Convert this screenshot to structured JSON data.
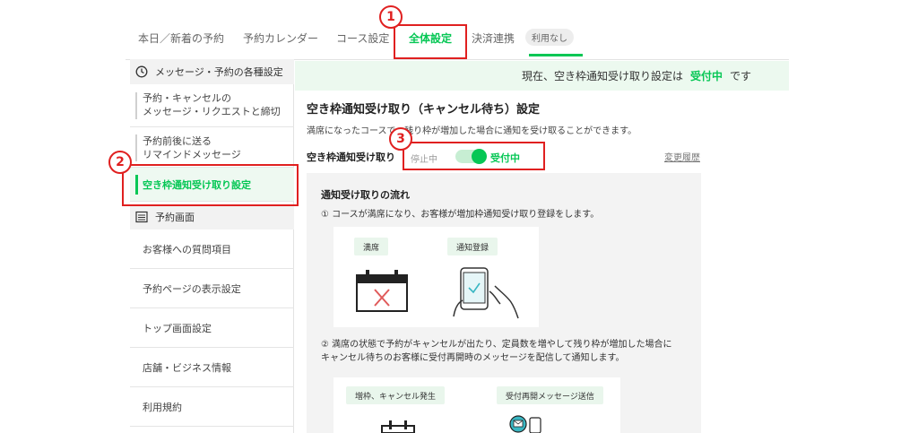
{
  "tabs": {
    "today": "本日／新着の予約",
    "calendar": "予約カレンダー",
    "course": "コース設定",
    "general": "全体設定",
    "payment": "決済連携",
    "payment_badge": "利用なし"
  },
  "sidebar": {
    "section_messages": "メッセージ・予約の各種設定",
    "item_booking_cancel_line1": "予約・キャンセルの",
    "item_booking_cancel_line2": "メッセージ・リクエストと締切",
    "item_remind_line1": "予約前後に送る",
    "item_remind_line2": "リマインドメッセージ",
    "item_waitlist": "空き枠通知受け取り設定",
    "section_booking_screen": "予約画面",
    "item_questions": "お客様への質問項目",
    "item_page_display": "予約ページの表示設定",
    "item_top_screen": "トップ画面設定",
    "item_store_info": "店舗・ビジネス情報",
    "item_terms": "利用規約"
  },
  "banner": {
    "prefix": "現在、空き枠通知受け取り設定は",
    "status": "受付中",
    "suffix": "です"
  },
  "main": {
    "title": "空き枠通知受け取り（キャンセル待ち）設定",
    "description": "満席になったコースで、残り枠が増加した場合に通知を受け取ることができます。",
    "toggle_label": "空き枠通知受け取り",
    "off_label": "停止中",
    "on_label": "受付中",
    "history_link": "変更履歴"
  },
  "flow": {
    "title": "通知受け取りの流れ",
    "step1": "① コースが満席になり、お客様が増加枠通知受け取り登録をします。",
    "pill_full": "満席",
    "pill_register": "通知登録",
    "step2_line1": "② 満席の状態で予約がキャンセルが出たり、定員数を増やして残り枠が増加した場合に",
    "step2_line2": "キャンセル待ちのお客様に受付再開時のメッセージを配信して通知します。",
    "pill_increase": "増枠、キャンセル発生",
    "pill_resume": "受付再開メッセージ送信"
  },
  "callouts": {
    "one": "1",
    "two": "2",
    "three": "3"
  },
  "colors": {
    "accent": "#06c755",
    "callout": "#e02020",
    "banner_bg": "#ecf9ef"
  }
}
